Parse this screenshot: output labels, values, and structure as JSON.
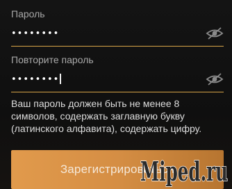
{
  "password": {
    "label": "Пароль",
    "value": "••••••••"
  },
  "repeat_password": {
    "label": "Повторите пароль",
    "value": "••••••••"
  },
  "hint": "Ваш пароль должен быть не менее 8 символов, содержать заглавную букву (латинского алфавита), содержать цифру.",
  "register_button_label": "Зарегистрироваться",
  "watermark": "Miped.ru",
  "colors": {
    "accent": "#d9a648",
    "button": "#d58e44",
    "background": "#121212"
  },
  "icons": {
    "password_toggle": "eye-off-icon",
    "repeat_toggle": "eye-off-icon"
  }
}
